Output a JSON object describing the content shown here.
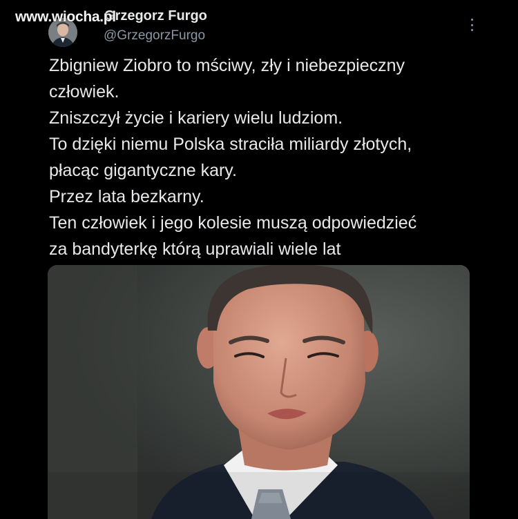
{
  "watermark": {
    "text": "www.wiocha.pl"
  },
  "tweet": {
    "author": {
      "name": "Grzegorz Furgo",
      "handle": "@GrzegorzFurgo",
      "avatar_icon": "avatar-photo"
    },
    "more_icon": "more-vertical-icon",
    "text_lines": [
      "Zbigniew Ziobro to mściwy, zły i niebezpieczny",
      "człowiek.",
      "Zniszczył życie i kariery wielu ludziom.",
      "To dzięki niemu Polska straciła miliardy złotych,",
      "płacąc gigantyczne kary.",
      "Przez lata bezkarny.",
      "Ten człowiek i jego kolesie muszą odpowiedzieć",
      "za bandyterkę którą uprawiali wiele lat"
    ],
    "media": {
      "kind": "photo",
      "subject": "portrait"
    }
  },
  "colors": {
    "background": "#000000",
    "text_primary": "#e7e9ea",
    "text_secondary": "#8b98a5"
  }
}
